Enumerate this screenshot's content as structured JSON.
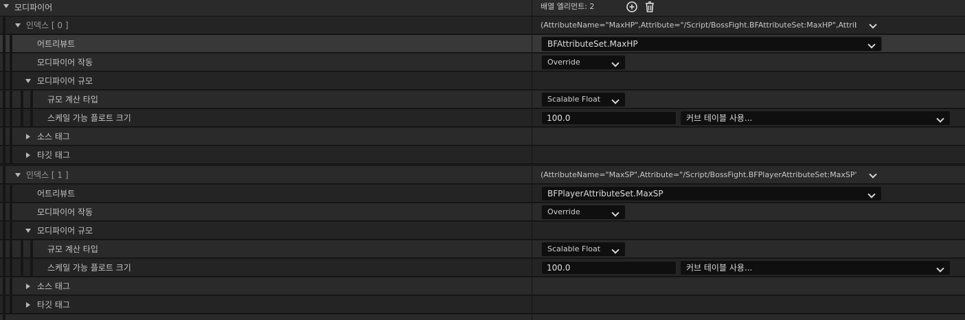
{
  "root": {
    "label": "모디파이어",
    "array_count_label": "배열 엘리먼트: 2",
    "add_icon": "plus-circle-icon",
    "delete_icon": "trash-icon"
  },
  "entries": [
    {
      "index_label": "인덱스 [ 0 ]",
      "summary": "(AttributeName=\"MaxHP\",Attribute=\"/Script/BossFight.BFAttributeSet:MaxHP\",AttributeOw",
      "attribute_label": "어트리뷰트",
      "attribute_value": "BFAttributeSet.MaxHP",
      "op_label": "모디파이어 작동",
      "op_value": "Override",
      "magnitude_label": "모디파이어 규모",
      "calc_type_label": "규모 계산 타입",
      "calc_type_value": "Scalable Float",
      "scalable_label": "스케일 가능 플로트 크기",
      "scalable_value": "100.0",
      "curve_table_value": "커브 테이블 사용...",
      "source_tags_label": "소스 태그",
      "target_tags_label": "타깃 태그"
    },
    {
      "index_label": "인덱스 [ 1 ]",
      "summary": "(AttributeName=\"MaxSP\",Attribute=\"/Script/BossFight.BFPlayerAttributeSet:MaxSP\",Attribu",
      "attribute_label": "어트리뷰트",
      "attribute_value": "BFPlayerAttributeSet.MaxSP",
      "op_label": "모디파이어 작동",
      "op_value": "Override",
      "magnitude_label": "모디파이어 규모",
      "calc_type_label": "규모 계산 타입",
      "calc_type_value": "Scalable Float",
      "scalable_label": "스케일 가능 플로트 크기",
      "scalable_value": "100.0",
      "curve_table_value": "커브 테이블 사용...",
      "source_tags_label": "소스 태그",
      "target_tags_label": "타깃 태그"
    }
  ]
}
